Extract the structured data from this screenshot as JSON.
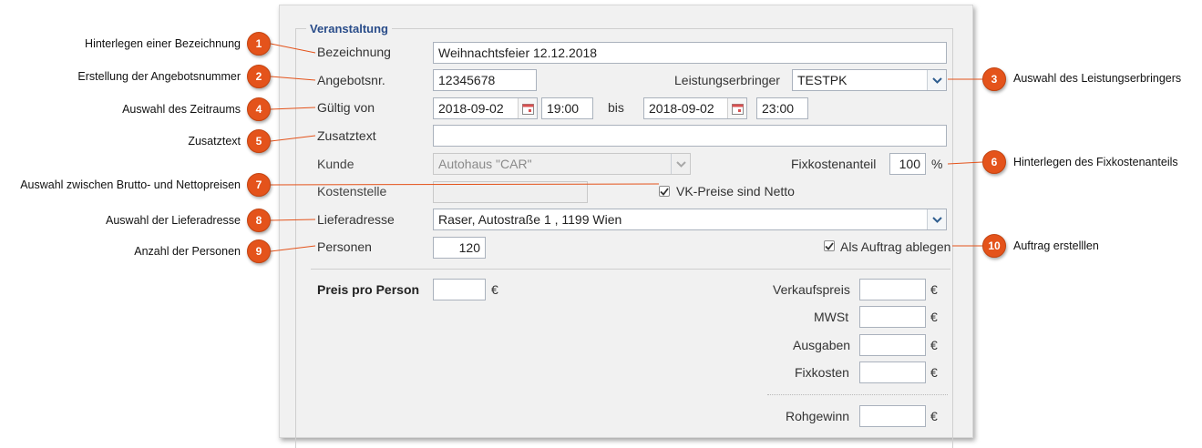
{
  "form": {
    "legend": "Veranstaltung",
    "bezeichnung_label": "Bezeichnung",
    "bezeichnung_value": "Weihnachtsfeier 12.12.2018",
    "angebotsnr_label": "Angebotsnr.",
    "angebotsnr_value": "12345678",
    "leistungserbringer_label": "Leistungserbringer",
    "leistungserbringer_value": "TESTPK",
    "gueltig_label": "Gültig von",
    "from_date": "2018-09-02",
    "from_time": "19:00",
    "bis_label": "bis",
    "to_date": "2018-09-02",
    "to_time": "23:00",
    "zusatztext_label": "Zusatztext",
    "zusatztext_value": "",
    "kunde_label": "Kunde",
    "kunde_value": "Autohaus \"CAR\"",
    "fixkostenanteil_label": "Fixkostenanteil",
    "fixkostenanteil_value": "100",
    "percent_sign": "%",
    "kostenstelle_label": "Kostenstelle",
    "kostenstelle_value": "",
    "vk_netto_label": "VK-Preise sind Netto",
    "vk_netto_checked": true,
    "lieferadresse_label": "Lieferadresse",
    "lieferadresse_value": "Raser, Autostraße 1 , 1199 Wien",
    "personen_label": "Personen",
    "personen_value": "120",
    "auftrag_label": "Als Auftrag ablegen",
    "auftrag_checked": true,
    "preis_pro_person_label": "Preis pro Person",
    "euro": "€",
    "verkaufspreis_label": "Verkaufspreis",
    "mwst_label": "MWSt",
    "ausgaben_label": "Ausgaben",
    "fixkosten_label": "Fixkosten",
    "rohgewinn_label": "Rohgewinn"
  },
  "annotations": [
    {
      "num": "1",
      "text": "Hinterlegen einer Bezeichnung"
    },
    {
      "num": "2",
      "text": "Erstellung der Angebotsnummer"
    },
    {
      "num": "3",
      "text": "Auswahl des Leistungserbringers"
    },
    {
      "num": "4",
      "text": "Auswahl des Zeitraums"
    },
    {
      "num": "5",
      "text": "Zusatztext"
    },
    {
      "num": "6",
      "text": "Hinterlegen des Fixkostenanteils"
    },
    {
      "num": "7",
      "text": "Auswahl zwischen Brutto- und Nettopreisen"
    },
    {
      "num": "8",
      "text": "Auswahl der Lieferadresse"
    },
    {
      "num": "9",
      "text": "Anzahl der Personen"
    },
    {
      "num": "10",
      "text": "Auftrag erstelllen"
    }
  ],
  "colors": {
    "badge": "#e4531b",
    "legend": "#2a4d8a",
    "panel": "#f1f1f1"
  }
}
